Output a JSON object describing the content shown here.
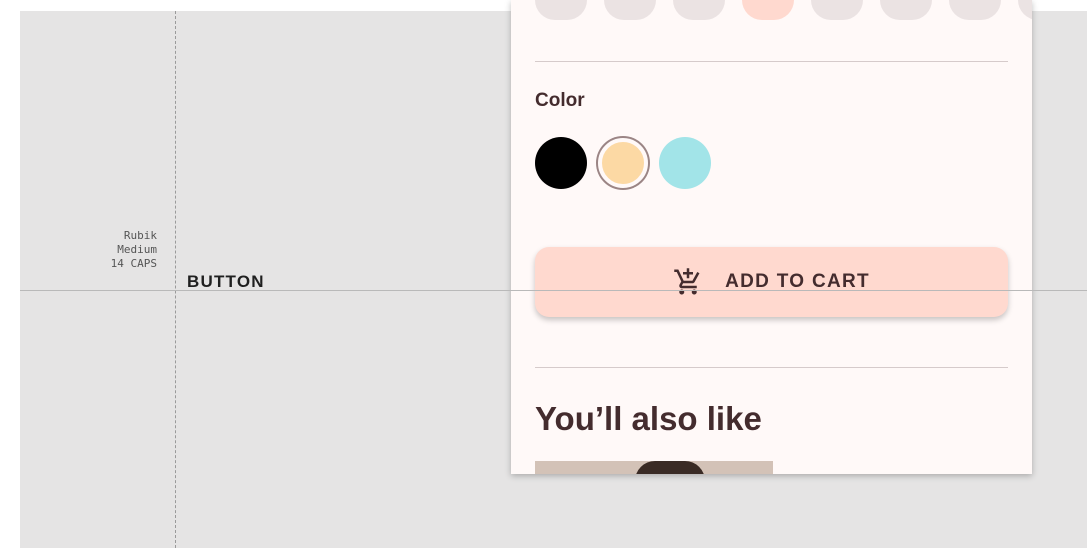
{
  "spec": {
    "font_name": "Rubik",
    "font_weight": "Medium",
    "font_size_caps": "14 CAPS",
    "sample_text": "BUTTON"
  },
  "product": {
    "size_options_visible": 8,
    "selected_size_index": 3,
    "color_label": "Color",
    "colors": [
      {
        "name": "black",
        "hex": "#000000",
        "selected": false
      },
      {
        "name": "tan",
        "hex": "#FCD9A4",
        "selected": true
      },
      {
        "name": "teal",
        "hex": "#A2E4E8",
        "selected": false
      }
    ],
    "add_to_cart_label": "ADD TO CART",
    "also_like_heading": "You’ll also like"
  },
  "theme": {
    "accent": "#FFD9CF",
    "text": "#442C2E",
    "surface": "#FFF9F8",
    "canvas": "#E5E4E4"
  },
  "icons": {
    "cart": "add-shopping-cart-icon"
  }
}
